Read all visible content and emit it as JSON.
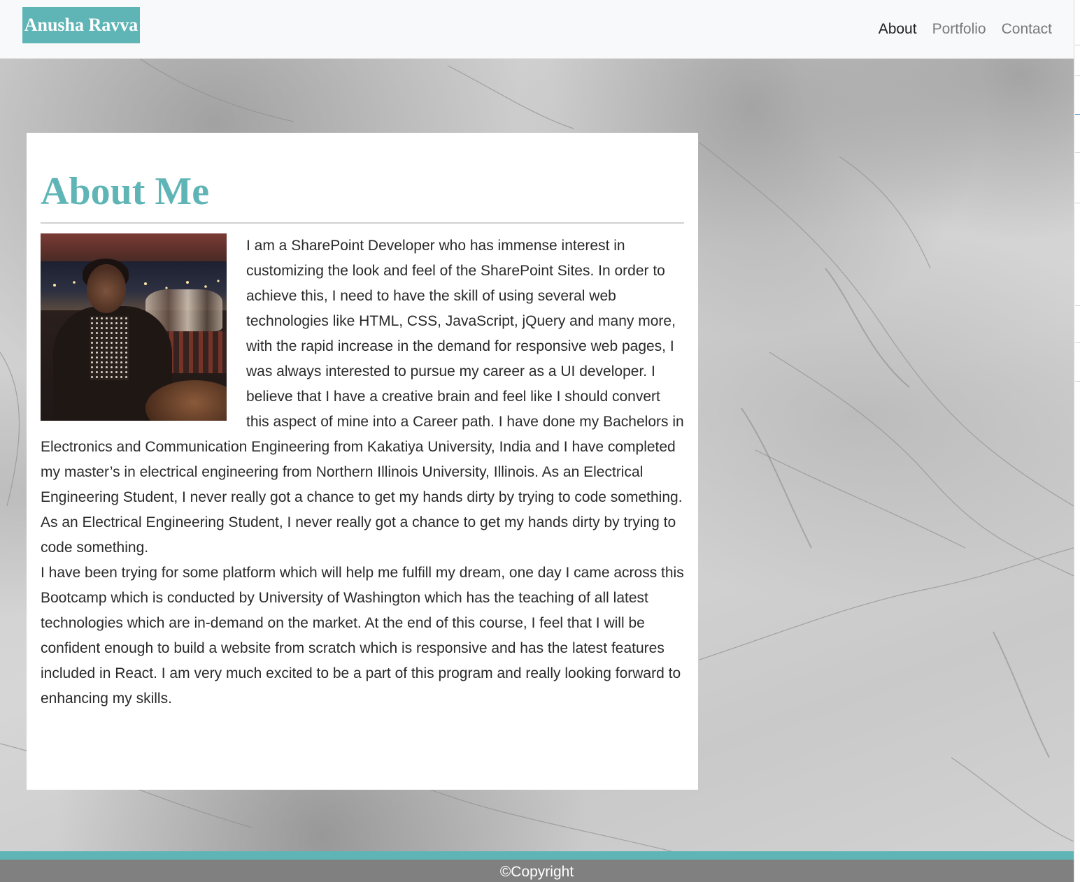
{
  "navbar": {
    "brand": "Anusha Ravva",
    "links": [
      {
        "label": "About",
        "active": true
      },
      {
        "label": "Portfolio",
        "active": false
      },
      {
        "label": "Contact",
        "active": false
      }
    ]
  },
  "about": {
    "title": "About Me",
    "photo_alt": "Profile photo",
    "paragraph1": "I am a SharePoint Developer who has immense interest in customizing the look and feel of the SharePoint Sites. In order to achieve this, I need to have the skill of using several web technologies like HTML, CSS, JavaScript, jQuery and many more, with the rapid increase in the demand for responsive web pages, I was always interested to pursue my career as a UI developer. I believe that I have a creative brain and feel like I should convert this aspect of mine into a Career path. I have done my Bachelors in Electronics and Communication Engineering from Kakatiya University, India and I have completed my master’s in electrical engineering from Northern Illinois University, Illinois. As an Electrical Engineering Student, I never really got a chance to get my hands dirty by trying to code something. As an Electrical Engineering Student, I never really got a chance to get my hands dirty by trying to code something.",
    "paragraph2": "I have been trying for some platform which will help me fulfill my dream, one day I came across this Bootcamp which is conducted by University of Washington which has the teaching of all latest technologies which are in-demand on the market. At the end of this course, I feel that I will be confident enough to build a website from scratch which is responsive and has the latest features included in React. I am very much excited to be a part of this program and really looking forward to enhancing my skills."
  },
  "footer": {
    "text": "©Copyright"
  },
  "colors": {
    "accent": "#5fb5b6",
    "footer_bg": "#808080",
    "navbar_bg": "#f8f9fa"
  }
}
